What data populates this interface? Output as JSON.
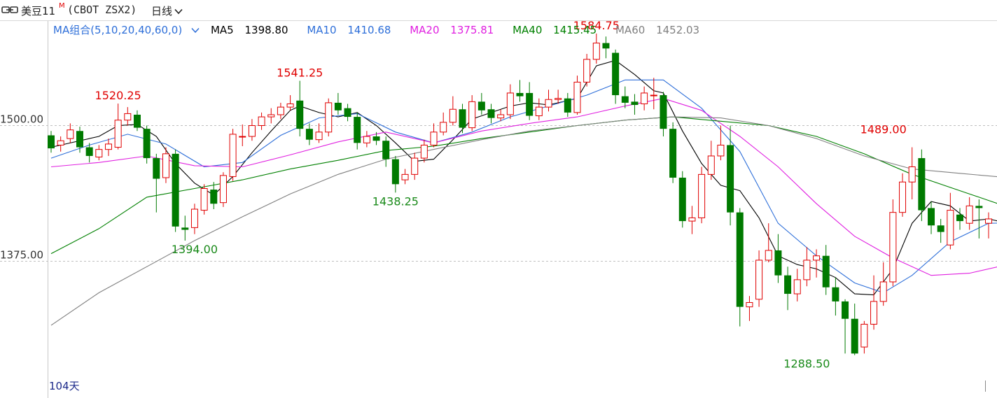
{
  "header": {
    "name": "美豆11",
    "superscript": "M",
    "code": "(CBOT ZSX2)",
    "period": "日线"
  },
  "legend": {
    "combo_label": "MA组合(5,10,20,40,60,0)",
    "items": [
      {
        "label": "MA5",
        "value": "1398.80",
        "color": "#000000"
      },
      {
        "label": "MA10",
        "value": "1410.68",
        "color": "#2e6fd9"
      },
      {
        "label": "MA20",
        "value": "1375.81",
        "color": "#e020e0"
      },
      {
        "label": "MA40",
        "value": "1415.45",
        "color": "#008000"
      },
      {
        "label": "MA60",
        "value": "1452.03",
        "color": "#808080"
      }
    ]
  },
  "days_label": "104天",
  "colors": {
    "up": "#e00000",
    "down": "#007a00",
    "grid": "#c0c0c0"
  },
  "chart_data": {
    "type": "candlestick",
    "y_ticks": [
      1500.0,
      1375.0
    ],
    "y_tick_labels": [
      "1500.00",
      "1375.00"
    ],
    "ylim": [
      1290,
      1600
    ],
    "annotations": [
      {
        "index": 7,
        "price": 1520.25,
        "text": "1520.25",
        "kind": "high"
      },
      {
        "index": 15,
        "price": 1394.0,
        "text": "1394.00",
        "kind": "low"
      },
      {
        "index": 26,
        "price": 1541.25,
        "text": "1541.25",
        "kind": "high"
      },
      {
        "index": 36,
        "price": 1438.25,
        "text": "1438.25",
        "kind": "low"
      },
      {
        "index": 57,
        "price": 1584.75,
        "text": "1584.75",
        "kind": "high"
      },
      {
        "index": 87,
        "price": 1489.0,
        "text": "1489.00",
        "kind": "high"
      },
      {
        "index": 79,
        "price": 1288.5,
        "text": "1288.50",
        "kind": "low"
      }
    ],
    "candles": [
      [
        1491,
        1479,
        1495,
        1475
      ],
      [
        1482,
        1486,
        1490,
        1476
      ],
      [
        1488,
        1496,
        1502,
        1484
      ],
      [
        1495,
        1480,
        1499,
        1475
      ],
      [
        1480,
        1472,
        1484,
        1466
      ],
      [
        1471,
        1478,
        1482,
        1468
      ],
      [
        1478,
        1483,
        1488,
        1472
      ],
      [
        1480,
        1505,
        1520.25,
        1478
      ],
      [
        1505,
        1511,
        1517,
        1500
      ],
      [
        1510,
        1498,
        1514,
        1495
      ],
      [
        1497,
        1470,
        1500,
        1465
      ],
      [
        1470,
        1451,
        1474,
        1420
      ],
      [
        1452,
        1474,
        1480,
        1447
      ],
      [
        1474,
        1407,
        1478,
        1402
      ],
      [
        1406,
        1404,
        1417,
        1394
      ],
      [
        1406,
        1423,
        1428,
        1400
      ],
      [
        1422,
        1442,
        1446,
        1418
      ],
      [
        1441,
        1428,
        1448,
        1423
      ],
      [
        1429,
        1454,
        1457,
        1425
      ],
      [
        1453,
        1492,
        1497,
        1449
      ],
      [
        1490,
        1490,
        1501,
        1481
      ],
      [
        1490,
        1500,
        1506,
        1486
      ],
      [
        1500,
        1508,
        1512,
        1496
      ],
      [
        1508,
        1510,
        1516,
        1502
      ],
      [
        1510,
        1517,
        1521,
        1506
      ],
      [
        1517,
        1520,
        1528,
        1514
      ],
      [
        1523,
        1497,
        1541.25,
        1490
      ],
      [
        1497,
        1487,
        1502,
        1482
      ],
      [
        1487,
        1494,
        1502,
        1484
      ],
      [
        1494,
        1521,
        1525,
        1490
      ],
      [
        1521,
        1514,
        1530,
        1510
      ],
      [
        1516,
        1508,
        1520,
        1504
      ],
      [
        1508,
        1484,
        1512,
        1478
      ],
      [
        1484,
        1490,
        1495,
        1480
      ],
      [
        1490,
        1486,
        1494,
        1482
      ],
      [
        1486,
        1469,
        1490,
        1462
      ],
      [
        1469,
        1446,
        1472,
        1438.25
      ],
      [
        1450,
        1455,
        1460,
        1446
      ],
      [
        1455,
        1470,
        1475,
        1450
      ],
      [
        1470,
        1482,
        1487,
        1466
      ],
      [
        1482,
        1494,
        1502,
        1480
      ],
      [
        1494,
        1503,
        1512,
        1491
      ],
      [
        1503,
        1515,
        1527,
        1500
      ],
      [
        1515,
        1498,
        1520,
        1493
      ],
      [
        1498,
        1522,
        1528,
        1495
      ],
      [
        1522,
        1514,
        1530,
        1510
      ],
      [
        1515,
        1507,
        1520,
        1502
      ],
      [
        1507,
        1510,
        1515,
        1504
      ],
      [
        1510,
        1530,
        1538,
        1506
      ],
      [
        1530,
        1527,
        1542,
        1522
      ],
      [
        1530,
        1509,
        1540,
        1505
      ],
      [
        1509,
        1517,
        1525,
        1505
      ],
      [
        1517,
        1524,
        1533,
        1513
      ],
      [
        1524,
        1525,
        1533,
        1520
      ],
      [
        1525,
        1512,
        1530,
        1508
      ],
      [
        1512,
        1540,
        1546,
        1510
      ],
      [
        1540,
        1561,
        1566,
        1536
      ],
      [
        1561,
        1576,
        1584.75,
        1557
      ],
      [
        1576,
        1571,
        1582,
        1562
      ],
      [
        1567,
        1528,
        1570,
        1520
      ],
      [
        1527,
        1521,
        1536,
        1516
      ],
      [
        1522,
        1519,
        1529,
        1510
      ],
      [
        1520,
        1530,
        1536,
        1514
      ],
      [
        1528,
        1528,
        1544,
        1515
      ],
      [
        1528,
        1497,
        1531,
        1490
      ],
      [
        1497,
        1452,
        1503,
        1447
      ],
      [
        1452,
        1412,
        1458,
        1406
      ],
      [
        1412,
        1415,
        1426,
        1400
      ],
      [
        1415,
        1455,
        1462,
        1410
      ],
      [
        1455,
        1472,
        1486,
        1450
      ],
      [
        1472,
        1482,
        1500,
        1468
      ],
      [
        1482,
        1420,
        1500,
        1408
      ],
      [
        1420,
        1333,
        1424,
        1315
      ],
      [
        1333,
        1337,
        1343,
        1320
      ],
      [
        1340,
        1376,
        1385,
        1333
      ],
      [
        1376,
        1385,
        1410,
        1374
      ],
      [
        1385,
        1362,
        1400,
        1355
      ],
      [
        1362,
        1345,
        1370,
        1330
      ],
      [
        1345,
        1358,
        1368,
        1338
      ],
      [
        1358,
        1376,
        1388,
        1352
      ],
      [
        1376,
        1380,
        1386,
        1360
      ],
      [
        1380,
        1351,
        1390,
        1344
      ],
      [
        1351,
        1338,
        1360,
        1325
      ],
      [
        1338,
        1322,
        1340,
        1290
      ],
      [
        1322,
        1290,
        1336,
        1288.5
      ],
      [
        1296,
        1317,
        1320,
        1290
      ],
      [
        1317,
        1338,
        1362,
        1312
      ],
      [
        1338,
        1356,
        1374,
        1334
      ],
      [
        1356,
        1420,
        1432,
        1352
      ],
      [
        1420,
        1448,
        1456,
        1416
      ],
      [
        1448,
        1462,
        1480,
        1432
      ],
      [
        1470,
        1422,
        1478,
        1412
      ],
      [
        1424,
        1408,
        1430,
        1400
      ],
      [
        1408,
        1402,
        1414,
        1392
      ],
      [
        1390,
        1422,
        1438,
        1386
      ],
      [
        1418,
        1412,
        1424,
        1404
      ],
      [
        1410,
        1426,
        1434,
        1404
      ],
      [
        1426,
        1424,
        1432,
        1396
      ],
      [
        1410,
        1414,
        1420,
        1396
      ]
    ],
    "series": [
      {
        "name": "MA5",
        "color": "#000000",
        "values": [
          [
            0,
            1480
          ],
          [
            5,
            1490
          ],
          [
            7,
            1500
          ],
          [
            9,
            1501
          ],
          [
            11,
            1490
          ],
          [
            13,
            1465
          ],
          [
            15,
            1447
          ],
          [
            17,
            1436
          ],
          [
            19,
            1453
          ],
          [
            21,
            1475
          ],
          [
            23,
            1495
          ],
          [
            25,
            1514
          ],
          [
            26,
            1518
          ],
          [
            28,
            1512
          ],
          [
            30,
            1508
          ],
          [
            32,
            1512
          ],
          [
            34,
            1500
          ],
          [
            36,
            1484
          ],
          [
            38,
            1467
          ],
          [
            40,
            1469
          ],
          [
            42,
            1487
          ],
          [
            44,
            1506
          ],
          [
            46,
            1512
          ],
          [
            48,
            1518
          ],
          [
            50,
            1521
          ],
          [
            52,
            1519
          ],
          [
            55,
            1525
          ],
          [
            57,
            1555
          ],
          [
            59,
            1560
          ],
          [
            61,
            1547
          ],
          [
            63,
            1532
          ],
          [
            64,
            1530
          ],
          [
            66,
            1495
          ],
          [
            68,
            1465
          ],
          [
            70,
            1445
          ],
          [
            72,
            1440
          ],
          [
            74,
            1415
          ],
          [
            76,
            1380
          ],
          [
            78,
            1372
          ],
          [
            80,
            1368
          ],
          [
            82,
            1360
          ],
          [
            84,
            1345
          ],
          [
            86,
            1344
          ],
          [
            88,
            1368
          ],
          [
            90,
            1410
          ],
          [
            92,
            1430
          ],
          [
            94,
            1426
          ],
          [
            96,
            1412
          ],
          [
            98,
            1414
          ],
          [
            100,
            1410
          ],
          [
            103,
            1398.8
          ]
        ]
      },
      {
        "name": "MA10",
        "color": "#2e6fd9",
        "values": [
          [
            0,
            1470
          ],
          [
            4,
            1482
          ],
          [
            8,
            1492
          ],
          [
            12,
            1483
          ],
          [
            16,
            1462
          ],
          [
            20,
            1466
          ],
          [
            24,
            1491
          ],
          [
            28,
            1507
          ],
          [
            32,
            1511
          ],
          [
            36,
            1494
          ],
          [
            40,
            1484
          ],
          [
            44,
            1494
          ],
          [
            48,
            1508
          ],
          [
            52,
            1518
          ],
          [
            56,
            1528
          ],
          [
            60,
            1542
          ],
          [
            64,
            1542
          ],
          [
            68,
            1516
          ],
          [
            72,
            1476
          ],
          [
            76,
            1410
          ],
          [
            80,
            1380
          ],
          [
            84,
            1355
          ],
          [
            87,
            1346
          ],
          [
            90,
            1362
          ],
          [
            94,
            1393
          ],
          [
            98,
            1410
          ],
          [
            103,
            1410.68
          ]
        ]
      },
      {
        "name": "MA20",
        "color": "#e020e0",
        "values": [
          [
            0,
            1462
          ],
          [
            5,
            1466
          ],
          [
            10,
            1472
          ],
          [
            15,
            1463
          ],
          [
            20,
            1462
          ],
          [
            25,
            1473
          ],
          [
            30,
            1485
          ],
          [
            35,
            1494
          ],
          [
            40,
            1484
          ],
          [
            45,
            1495
          ],
          [
            50,
            1502
          ],
          [
            55,
            1508
          ],
          [
            60,
            1518
          ],
          [
            64,
            1525
          ],
          [
            68,
            1514
          ],
          [
            72,
            1490
          ],
          [
            76,
            1462
          ],
          [
            80,
            1428
          ],
          [
            84,
            1398
          ],
          [
            88,
            1378
          ],
          [
            92,
            1362
          ],
          [
            96,
            1364
          ],
          [
            100,
            1372
          ],
          [
            103,
            1375.81
          ]
        ]
      },
      {
        "name": "MA40",
        "color": "#008000",
        "values": [
          [
            0,
            1382
          ],
          [
            5,
            1405
          ],
          [
            10,
            1434
          ],
          [
            15,
            1442
          ],
          [
            20,
            1450
          ],
          [
            25,
            1460
          ],
          [
            30,
            1468
          ],
          [
            35,
            1477
          ],
          [
            40,
            1481
          ],
          [
            45,
            1488
          ],
          [
            50,
            1494
          ],
          [
            55,
            1500
          ],
          [
            60,
            1505
          ],
          [
            65,
            1508
          ],
          [
            70,
            1504
          ],
          [
            75,
            1500
          ],
          [
            80,
            1490
          ],
          [
            85,
            1474
          ],
          [
            90,
            1455
          ],
          [
            95,
            1440
          ],
          [
            100,
            1425
          ],
          [
            103,
            1415.45
          ]
        ]
      },
      {
        "name": "MA60",
        "color": "#808080",
        "values": [
          [
            0,
            1316
          ],
          [
            5,
            1346
          ],
          [
            10,
            1370
          ],
          [
            15,
            1394
          ],
          [
            20,
            1416
          ],
          [
            25,
            1437
          ],
          [
            30,
            1455
          ],
          [
            35,
            1469
          ],
          [
            40,
            1478
          ],
          [
            45,
            1487
          ],
          [
            50,
            1495
          ],
          [
            55,
            1500
          ],
          [
            60,
            1505
          ],
          [
            65,
            1508
          ],
          [
            70,
            1507
          ],
          [
            75,
            1500
          ],
          [
            80,
            1488
          ],
          [
            85,
            1472
          ],
          [
            90,
            1460
          ],
          [
            95,
            1456
          ],
          [
            100,
            1452
          ],
          [
            103,
            1452.03
          ]
        ]
      }
    ]
  }
}
